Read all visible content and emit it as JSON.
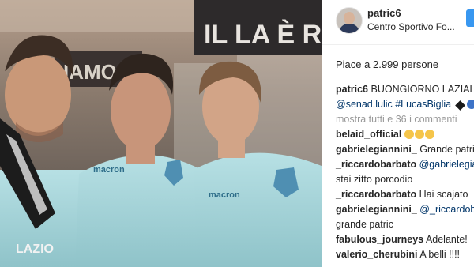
{
  "post": {
    "username": "patric6",
    "location": "Centro Sportivo Fo...",
    "likes_text": "Piace a 2.999 persone"
  },
  "caption": {
    "user": "patric6",
    "text": "BUONGIORNO LAZIALI!",
    "tags": "@senad.lulic #LucasBiglia"
  },
  "view_all": "mostra tutti e 36 i commenti",
  "comments": [
    {
      "user": "belaid_official",
      "text": ""
    },
    {
      "user": "gabrielegiannini_",
      "text": "Grande patric"
    },
    {
      "user": "_riccardobarbato",
      "text": "@gabrielegiannini_"
    },
    {
      "cont": "stai zitto porcodio"
    },
    {
      "user": "_riccardobarbato",
      "text": "Hai scajato"
    },
    {
      "user": "gabrielegiannini_",
      "text": "@_riccardobarbato"
    },
    {
      "cont": "grande patric"
    },
    {
      "user": "fabulous_journeys",
      "text": "Adelante!"
    },
    {
      "user": "valerio_cherubini",
      "text": "A belli !!!!"
    }
  ],
  "photo": {
    "wall_text_1": "IAMO",
    "wall_text_2": "IL LA È RO",
    "shirt_brand_1": "macron",
    "shirt_brand_2": "macron",
    "shirt_brand_3": "macron",
    "scarf_text": "LAZIO"
  },
  "colors": {
    "link": "#003569",
    "muted": "#999999",
    "follow": "#3897f0",
    "shirt": "#a9d7dc"
  },
  "icons": [
    "avatar",
    "follow-button",
    "heart-blue-emoji",
    "laughing-emoji"
  ]
}
